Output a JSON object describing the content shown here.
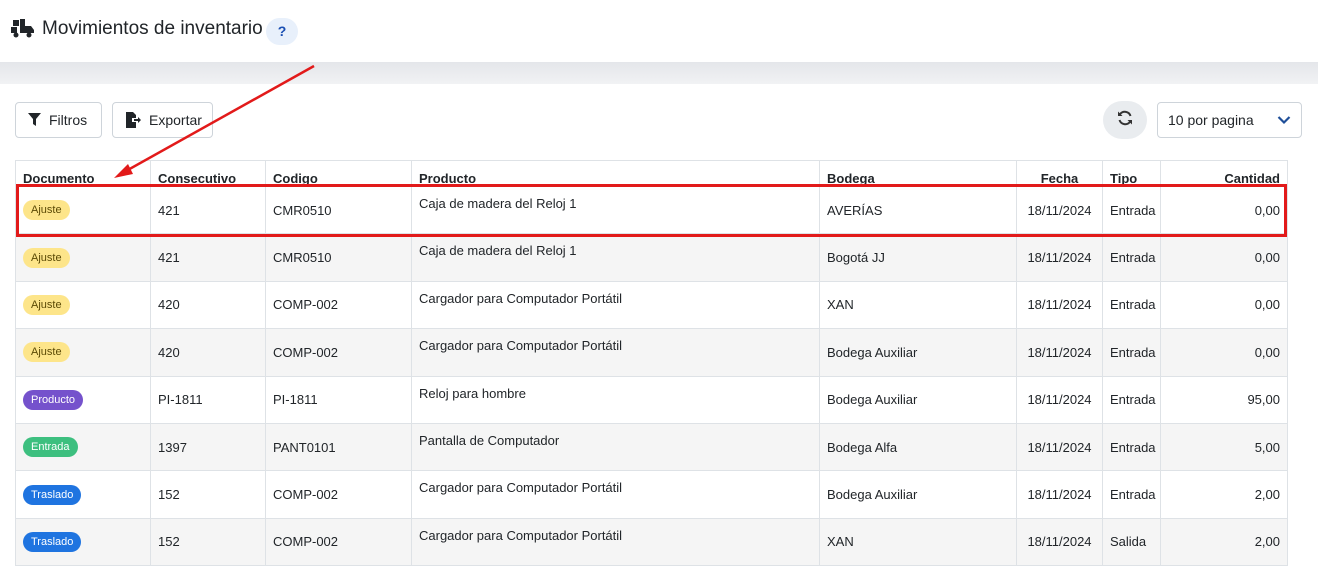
{
  "header": {
    "title": "Movimientos de inventario",
    "help_label": "?",
    "logo_icon": "truck-boxes-icon"
  },
  "toolbar": {
    "filters_label": "Filtros",
    "export_label": "Exportar",
    "refresh_icon": "refresh-icon",
    "per_page_value": "10 por pagina"
  },
  "table": {
    "columns": [
      "Documento",
      "Consecutivo",
      "Codigo",
      "Producto",
      "Bodega",
      "Fecha",
      "Tipo",
      "Cantidad"
    ],
    "rows": [
      {
        "documento": "Ajuste",
        "doc_color": "#fde58a",
        "consecutivo": "421",
        "codigo": "CMR0510",
        "producto": "Caja de madera del Reloj 1",
        "bodega": "AVERÍAS",
        "fecha": "18/11/2024",
        "tipo": "Entrada",
        "cantidad": "0,00"
      },
      {
        "documento": "Ajuste",
        "doc_color": "#fde58a",
        "consecutivo": "421",
        "codigo": "CMR0510",
        "producto": "Caja de madera del Reloj 1",
        "bodega": "Bogotá JJ",
        "fecha": "18/11/2024",
        "tipo": "Entrada",
        "cantidad": "0,00"
      },
      {
        "documento": "Ajuste",
        "doc_color": "#fde58a",
        "consecutivo": "420",
        "codigo": "COMP-002",
        "producto": "Cargador para Computador Portátil",
        "bodega": "XAN",
        "fecha": "18/11/2024",
        "tipo": "Entrada",
        "cantidad": "0,00"
      },
      {
        "documento": "Ajuste",
        "doc_color": "#fde58a",
        "consecutivo": "420",
        "codigo": "COMP-002",
        "producto": "Cargador para Computador Portátil",
        "bodega": "Bodega Auxiliar",
        "fecha": "18/11/2024",
        "tipo": "Entrada",
        "cantidad": "0,00"
      },
      {
        "documento": "Producto",
        "doc_color": "#7552cc",
        "consecutivo": "PI-1811",
        "codigo": "PI-1811",
        "producto": "Reloj para hombre",
        "bodega": "Bodega Auxiliar",
        "fecha": "18/11/2024",
        "tipo": "Entrada",
        "cantidad": "95,00"
      },
      {
        "documento": "Entrada",
        "doc_color": "#3dbf7f",
        "consecutivo": "1397",
        "codigo": "PANT0101",
        "producto": "Pantalla de Computador",
        "bodega": "Bodega Alfa",
        "fecha": "18/11/2024",
        "tipo": "Entrada",
        "cantidad": "5,00"
      },
      {
        "documento": "Traslado",
        "doc_color": "#1f74e0",
        "consecutivo": "152",
        "codigo": "COMP-002",
        "producto": "Cargador para Computador Portátil",
        "bodega": "Bodega Auxiliar",
        "fecha": "18/11/2024",
        "tipo": "Entrada",
        "cantidad": "2,00"
      },
      {
        "documento": "Traslado",
        "doc_color": "#1f74e0",
        "consecutivo": "152",
        "codigo": "COMP-002",
        "producto": "Cargador para Computador Portátil",
        "bodega": "XAN",
        "fecha": "18/11/2024",
        "tipo": "Salida",
        "cantidad": "2,00"
      }
    ]
  },
  "annotation": {
    "highlight_color": "#e21a1a"
  }
}
